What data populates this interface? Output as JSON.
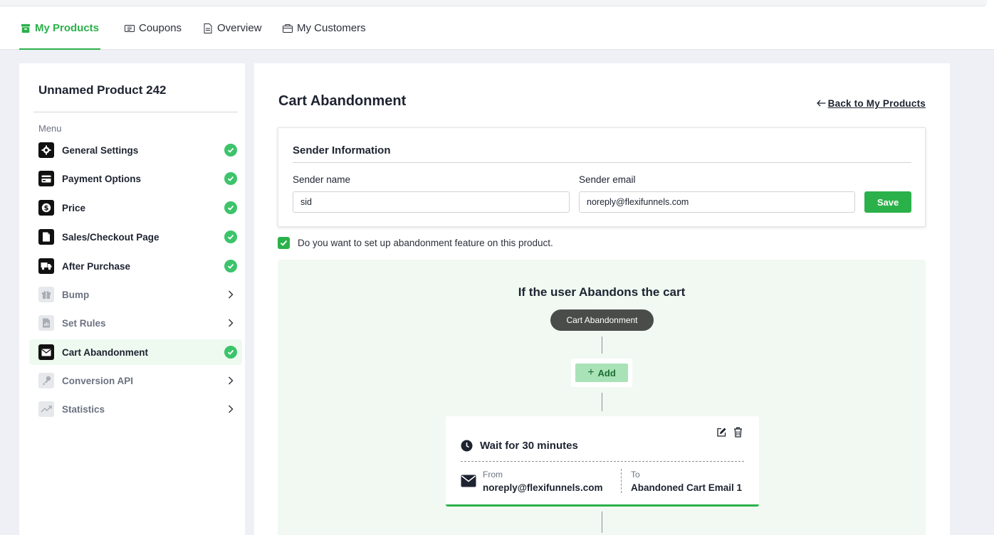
{
  "nav": {
    "tabs": [
      {
        "label": "My Products",
        "icon": "box-icon",
        "active": true
      },
      {
        "label": "Coupons",
        "icon": "ticket-icon",
        "active": false
      },
      {
        "label": "Overview",
        "icon": "document-icon",
        "active": false
      },
      {
        "label": "My Customers",
        "icon": "bag-icon",
        "active": false
      }
    ]
  },
  "sidebar": {
    "product_title": "Unnamed Product 242",
    "menu_label": "Menu",
    "items": [
      {
        "label": "General Settings",
        "icon": "gear-icon",
        "status": "complete"
      },
      {
        "label": "Payment Options",
        "icon": "credit-card-icon",
        "status": "complete"
      },
      {
        "label": "Price",
        "icon": "dollar-icon",
        "status": "complete"
      },
      {
        "label": "Sales/Checkout Page",
        "icon": "page-icon",
        "status": "complete"
      },
      {
        "label": "After Purchase",
        "icon": "truck-icon",
        "status": "complete"
      },
      {
        "label": "Bump",
        "icon": "gift-icon",
        "status": "incomplete"
      },
      {
        "label": "Set Rules",
        "icon": "rules-icon",
        "status": "incomplete"
      },
      {
        "label": "Cart Abandonment",
        "icon": "envelope-icon",
        "status": "complete",
        "selected": true
      },
      {
        "label": "Conversion API",
        "icon": "key-icon",
        "status": "incomplete"
      },
      {
        "label": "Statistics",
        "icon": "trend-icon",
        "status": "incomplete"
      }
    ]
  },
  "main": {
    "title": "Cart Abandonment",
    "back_link": "Back to My Products",
    "sender": {
      "title": "Sender Information",
      "name_label": "Sender name",
      "name_value": "sid",
      "email_label": "Sender email",
      "email_value": "noreply@flexifunnels.com",
      "save_label": "Save"
    },
    "consent_label": "Do you want to set up abandonment feature on this product.",
    "consent_checked": true,
    "flow": {
      "title": "If the user Abandons the cart",
      "trigger_label": "Cart Abandonment",
      "add_label": "Add",
      "step": {
        "wait_label": "Wait for 30 minutes",
        "from_label": "From",
        "from_value": "noreply@flexifunnels.com",
        "to_label": "To",
        "to_value": "Abandoned Cart Email 1"
      }
    }
  },
  "colors": {
    "accent": "#2bb14a",
    "check": "#3cc46a",
    "flow_bg": "#f1f9f2",
    "pill_bg": "#4a4c4a"
  }
}
